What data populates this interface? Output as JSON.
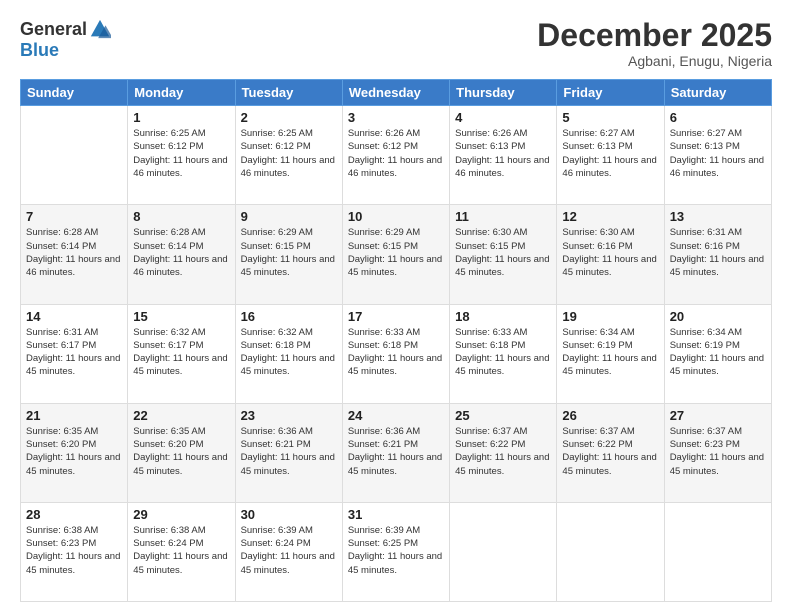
{
  "logo": {
    "general": "General",
    "blue": "Blue"
  },
  "header": {
    "month": "December 2025",
    "location": "Agbani, Enugu, Nigeria"
  },
  "weekdays": [
    "Sunday",
    "Monday",
    "Tuesday",
    "Wednesday",
    "Thursday",
    "Friday",
    "Saturday"
  ],
  "weeks": [
    [
      {
        "day": "",
        "sunrise": "",
        "sunset": "",
        "daylight": ""
      },
      {
        "day": "1",
        "sunrise": "Sunrise: 6:25 AM",
        "sunset": "Sunset: 6:12 PM",
        "daylight": "Daylight: 11 hours and 46 minutes."
      },
      {
        "day": "2",
        "sunrise": "Sunrise: 6:25 AM",
        "sunset": "Sunset: 6:12 PM",
        "daylight": "Daylight: 11 hours and 46 minutes."
      },
      {
        "day": "3",
        "sunrise": "Sunrise: 6:26 AM",
        "sunset": "Sunset: 6:12 PM",
        "daylight": "Daylight: 11 hours and 46 minutes."
      },
      {
        "day": "4",
        "sunrise": "Sunrise: 6:26 AM",
        "sunset": "Sunset: 6:13 PM",
        "daylight": "Daylight: 11 hours and 46 minutes."
      },
      {
        "day": "5",
        "sunrise": "Sunrise: 6:27 AM",
        "sunset": "Sunset: 6:13 PM",
        "daylight": "Daylight: 11 hours and 46 minutes."
      },
      {
        "day": "6",
        "sunrise": "Sunrise: 6:27 AM",
        "sunset": "Sunset: 6:13 PM",
        "daylight": "Daylight: 11 hours and 46 minutes."
      }
    ],
    [
      {
        "day": "7",
        "sunrise": "Sunrise: 6:28 AM",
        "sunset": "Sunset: 6:14 PM",
        "daylight": "Daylight: 11 hours and 46 minutes."
      },
      {
        "day": "8",
        "sunrise": "Sunrise: 6:28 AM",
        "sunset": "Sunset: 6:14 PM",
        "daylight": "Daylight: 11 hours and 46 minutes."
      },
      {
        "day": "9",
        "sunrise": "Sunrise: 6:29 AM",
        "sunset": "Sunset: 6:15 PM",
        "daylight": "Daylight: 11 hours and 45 minutes."
      },
      {
        "day": "10",
        "sunrise": "Sunrise: 6:29 AM",
        "sunset": "Sunset: 6:15 PM",
        "daylight": "Daylight: 11 hours and 45 minutes."
      },
      {
        "day": "11",
        "sunrise": "Sunrise: 6:30 AM",
        "sunset": "Sunset: 6:15 PM",
        "daylight": "Daylight: 11 hours and 45 minutes."
      },
      {
        "day": "12",
        "sunrise": "Sunrise: 6:30 AM",
        "sunset": "Sunset: 6:16 PM",
        "daylight": "Daylight: 11 hours and 45 minutes."
      },
      {
        "day": "13",
        "sunrise": "Sunrise: 6:31 AM",
        "sunset": "Sunset: 6:16 PM",
        "daylight": "Daylight: 11 hours and 45 minutes."
      }
    ],
    [
      {
        "day": "14",
        "sunrise": "Sunrise: 6:31 AM",
        "sunset": "Sunset: 6:17 PM",
        "daylight": "Daylight: 11 hours and 45 minutes."
      },
      {
        "day": "15",
        "sunrise": "Sunrise: 6:32 AM",
        "sunset": "Sunset: 6:17 PM",
        "daylight": "Daylight: 11 hours and 45 minutes."
      },
      {
        "day": "16",
        "sunrise": "Sunrise: 6:32 AM",
        "sunset": "Sunset: 6:18 PM",
        "daylight": "Daylight: 11 hours and 45 minutes."
      },
      {
        "day": "17",
        "sunrise": "Sunrise: 6:33 AM",
        "sunset": "Sunset: 6:18 PM",
        "daylight": "Daylight: 11 hours and 45 minutes."
      },
      {
        "day": "18",
        "sunrise": "Sunrise: 6:33 AM",
        "sunset": "Sunset: 6:18 PM",
        "daylight": "Daylight: 11 hours and 45 minutes."
      },
      {
        "day": "19",
        "sunrise": "Sunrise: 6:34 AM",
        "sunset": "Sunset: 6:19 PM",
        "daylight": "Daylight: 11 hours and 45 minutes."
      },
      {
        "day": "20",
        "sunrise": "Sunrise: 6:34 AM",
        "sunset": "Sunset: 6:19 PM",
        "daylight": "Daylight: 11 hours and 45 minutes."
      }
    ],
    [
      {
        "day": "21",
        "sunrise": "Sunrise: 6:35 AM",
        "sunset": "Sunset: 6:20 PM",
        "daylight": "Daylight: 11 hours and 45 minutes."
      },
      {
        "day": "22",
        "sunrise": "Sunrise: 6:35 AM",
        "sunset": "Sunset: 6:20 PM",
        "daylight": "Daylight: 11 hours and 45 minutes."
      },
      {
        "day": "23",
        "sunrise": "Sunrise: 6:36 AM",
        "sunset": "Sunset: 6:21 PM",
        "daylight": "Daylight: 11 hours and 45 minutes."
      },
      {
        "day": "24",
        "sunrise": "Sunrise: 6:36 AM",
        "sunset": "Sunset: 6:21 PM",
        "daylight": "Daylight: 11 hours and 45 minutes."
      },
      {
        "day": "25",
        "sunrise": "Sunrise: 6:37 AM",
        "sunset": "Sunset: 6:22 PM",
        "daylight": "Daylight: 11 hours and 45 minutes."
      },
      {
        "day": "26",
        "sunrise": "Sunrise: 6:37 AM",
        "sunset": "Sunset: 6:22 PM",
        "daylight": "Daylight: 11 hours and 45 minutes."
      },
      {
        "day": "27",
        "sunrise": "Sunrise: 6:37 AM",
        "sunset": "Sunset: 6:23 PM",
        "daylight": "Daylight: 11 hours and 45 minutes."
      }
    ],
    [
      {
        "day": "28",
        "sunrise": "Sunrise: 6:38 AM",
        "sunset": "Sunset: 6:23 PM",
        "daylight": "Daylight: 11 hours and 45 minutes."
      },
      {
        "day": "29",
        "sunrise": "Sunrise: 6:38 AM",
        "sunset": "Sunset: 6:24 PM",
        "daylight": "Daylight: 11 hours and 45 minutes."
      },
      {
        "day": "30",
        "sunrise": "Sunrise: 6:39 AM",
        "sunset": "Sunset: 6:24 PM",
        "daylight": "Daylight: 11 hours and 45 minutes."
      },
      {
        "day": "31",
        "sunrise": "Sunrise: 6:39 AM",
        "sunset": "Sunset: 6:25 PM",
        "daylight": "Daylight: 11 hours and 45 minutes."
      },
      {
        "day": "",
        "sunrise": "",
        "sunset": "",
        "daylight": ""
      },
      {
        "day": "",
        "sunrise": "",
        "sunset": "",
        "daylight": ""
      },
      {
        "day": "",
        "sunrise": "",
        "sunset": "",
        "daylight": ""
      }
    ]
  ]
}
